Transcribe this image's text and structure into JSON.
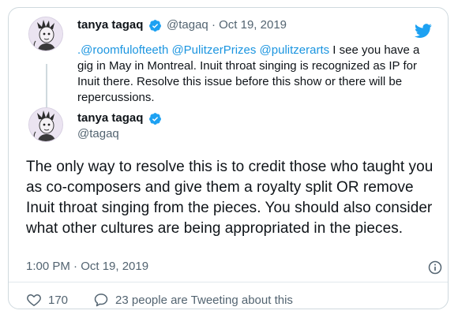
{
  "reply_tweet": {
    "author_name": "tanya tagaq",
    "handle": "@tagaq",
    "separator": "·",
    "date": "Oct 19, 2019",
    "mentions": ".@roomfulofteeth @PulitzerPrizes @pulitzerarts",
    "text": " I see you have a gig in May in Montreal. Inuit throat singing is recognized as IP for Inuit there. Resolve this issue before this show or there will be repercussions."
  },
  "main_tweet": {
    "author_name": "tanya tagaq",
    "handle": "@tagaq",
    "text": "The only way to resolve this is to credit those who taught you as co-composers and give them a royalty split OR remove Inuit throat singing from the pieces. You should also consider what other cultures are being appropriated in the pieces.",
    "timestamp": "1:00 PM · Oct 19, 2019"
  },
  "actions": {
    "like_count": "170",
    "tweeting_about": "23 people are Tweeting about this"
  },
  "icons": {
    "brand": "twitter-bird-icon",
    "verified": "verified-badge-icon",
    "info": "info-icon",
    "like": "heart-icon",
    "reply": "speech-bubble-icon"
  },
  "colors": {
    "accent": "#1b95e0",
    "text": "#0f1419",
    "muted": "#536471",
    "border": "#cfd9de"
  }
}
